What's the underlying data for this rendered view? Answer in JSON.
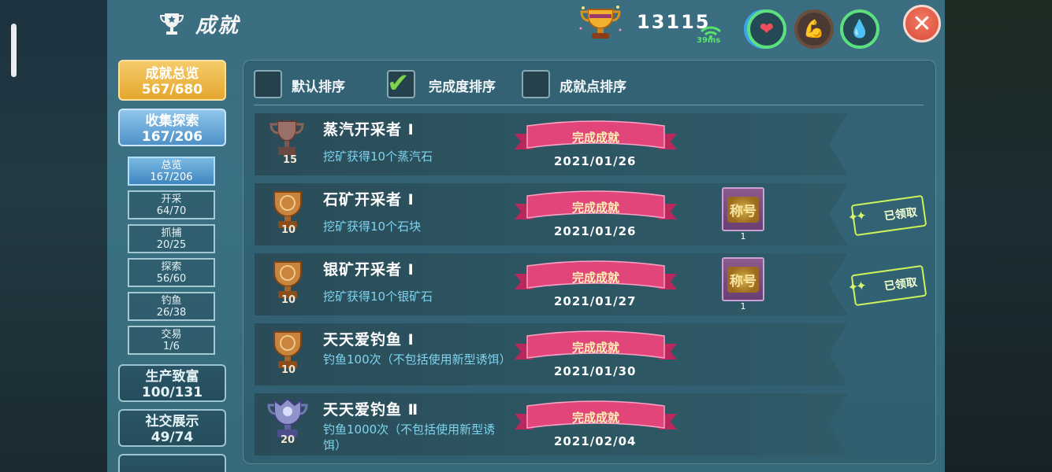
{
  "header": {
    "title": "成就",
    "points": "13115",
    "ping": "39ms",
    "close_label": "✕"
  },
  "nav": {
    "overview": {
      "label": "成就总览",
      "count": "567/680"
    },
    "collect": {
      "label": "收集探索",
      "count": "167/206"
    },
    "sub": [
      {
        "label": "总览",
        "count": "167/206"
      },
      {
        "label": "开采",
        "count": "64/70"
      },
      {
        "label": "抓捕",
        "count": "20/25"
      },
      {
        "label": "探索",
        "count": "56/60"
      },
      {
        "label": "钓鱼",
        "count": "26/38"
      },
      {
        "label": "交易",
        "count": "1/6"
      }
    ],
    "wealth": {
      "label": "生产致富",
      "count": "100/131"
    },
    "social": {
      "label": "社交展示",
      "count": "49/74"
    }
  },
  "sort": {
    "default_label": "默认排序",
    "completion_label": "完成度排序",
    "points_label": "成就点排序",
    "selected": "completion"
  },
  "rows": [
    {
      "title": "蒸汽开采者 Ⅰ",
      "desc": "挖矿获得10个蒸汽石",
      "points": "15",
      "status": "完成成就",
      "date": "2021/01/26",
      "medal": "bronze-dark"
    },
    {
      "title": "石矿开采者 Ⅰ",
      "desc": "挖矿获得10个石块",
      "points": "10",
      "status": "完成成就",
      "date": "2021/01/26",
      "medal": "bronze",
      "reward_label": "称号",
      "reward_count": "1",
      "claimed_label": "已领取"
    },
    {
      "title": "银矿开采者 Ⅰ",
      "desc": "挖矿获得10个银矿石",
      "points": "10",
      "status": "完成成就",
      "date": "2021/01/27",
      "medal": "bronze",
      "reward_label": "称号",
      "reward_count": "1",
      "claimed_label": "已领取"
    },
    {
      "title": "天天爱钓鱼 Ⅰ",
      "desc": "钓鱼100次（不包括使用新型诱饵）",
      "points": "10",
      "status": "完成成就",
      "date": "2021/01/30",
      "medal": "bronze"
    },
    {
      "title": "天天爱钓鱼 Ⅱ",
      "desc": "钓鱼1000次（不包括使用新型诱饵）",
      "points": "20",
      "status": "完成成就",
      "date": "2021/02/04",
      "medal": "silver"
    }
  ],
  "icons": {
    "title": "trophy-icon",
    "points": "gold-trophy-icon",
    "wifi": "wifi-icon",
    "health": "heart-icon",
    "strength": "arm-icon",
    "water": "water-drop-icon"
  },
  "colors": {
    "panel": "#3a7183",
    "gold_tab": "#e5a72f",
    "blue_tab": "#4f91c7",
    "ribbon": "#e2457a",
    "desc_text": "#7fd4ef",
    "check": "#7fd34f"
  }
}
